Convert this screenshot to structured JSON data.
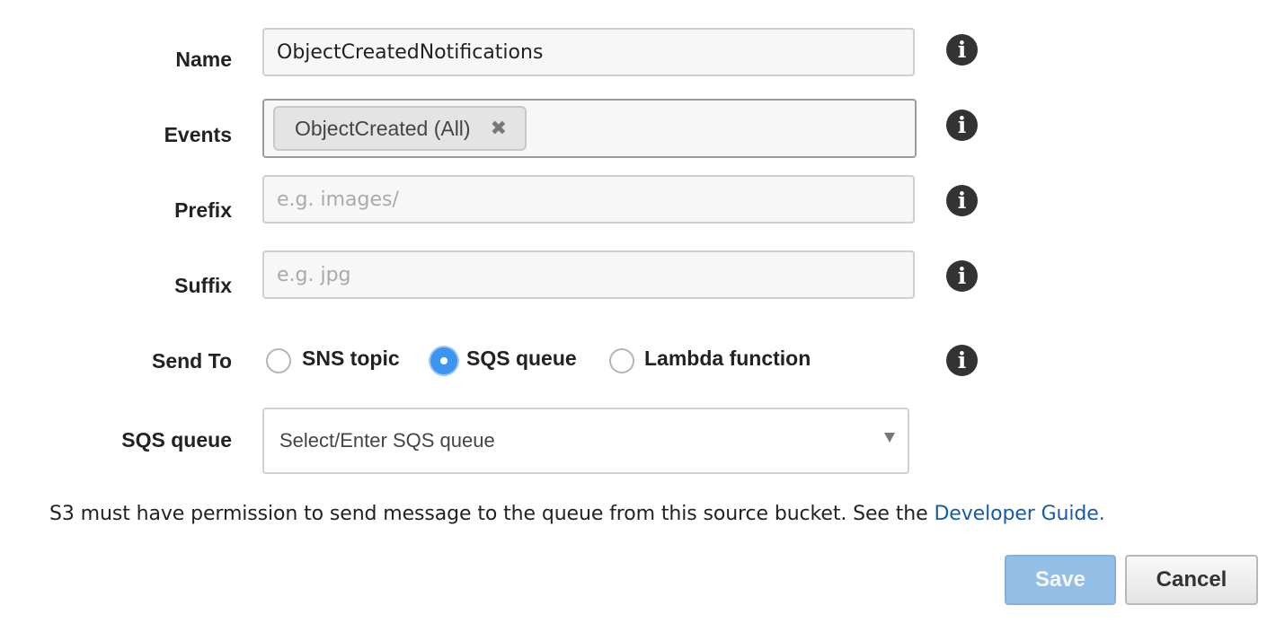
{
  "form": {
    "name": {
      "label": "Name",
      "value": "ObjectCreatedNotifications"
    },
    "events": {
      "label": "Events",
      "tokens": [
        "ObjectCreated (All)"
      ],
      "remove_glyph": "✖"
    },
    "prefix": {
      "label": "Prefix",
      "placeholder": "e.g. images/"
    },
    "suffix": {
      "label": "Suffix",
      "placeholder": "e.g. jpg"
    },
    "send_to": {
      "label": "Send To",
      "options": [
        {
          "label": "SNS topic",
          "checked": false
        },
        {
          "label": "SQS queue",
          "checked": true
        },
        {
          "label": "Lambda function",
          "checked": false
        }
      ]
    },
    "sqs_queue": {
      "label": "SQS queue",
      "placeholder": "Select/Enter SQS queue"
    }
  },
  "info_icon": {
    "glyph": "i",
    "icon": "info-icon"
  },
  "notice": {
    "text": "S3 must have permission to send message to the queue from this source bucket. See the ",
    "link_text": "Developer Guide."
  },
  "buttons": {
    "save": "Save",
    "cancel": "Cancel"
  },
  "colors": {
    "accent": "#3e94f0",
    "link": "#1a5aa3",
    "save_disabled": "#93bfe6"
  }
}
